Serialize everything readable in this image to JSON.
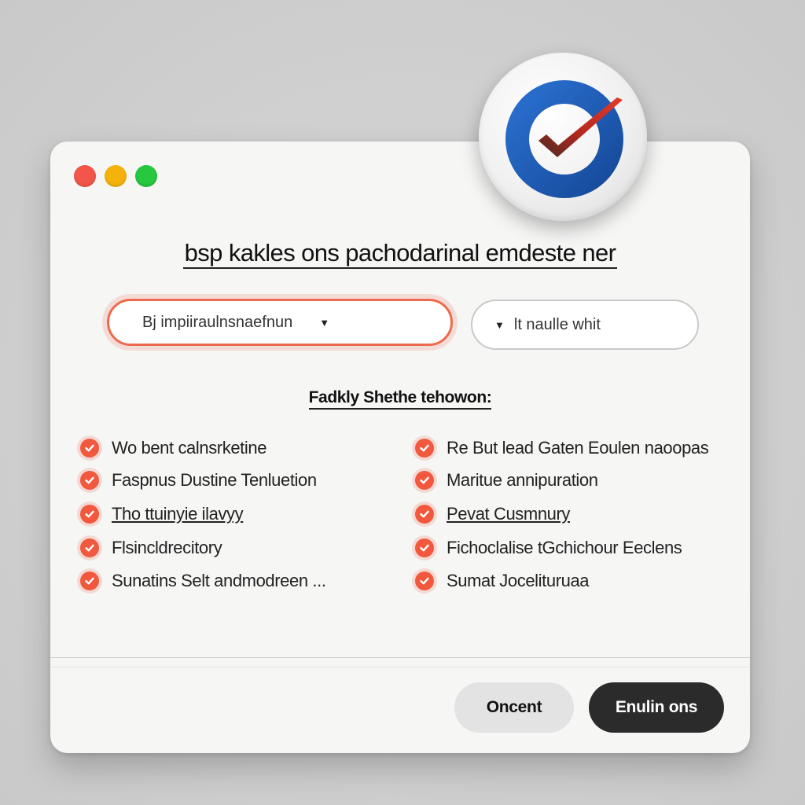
{
  "window": {
    "heading": "bsp kakles ons pachodarinal emdeste ner",
    "subheading": "Fadkly Shethe tehowon:",
    "select_primary": {
      "value": "Bj impiiraulnsnaefnun"
    },
    "select_secondary": {
      "value": "lt naulle whit"
    },
    "features_left": [
      {
        "label": "Wo bent calnsrketine"
      },
      {
        "label": "Faspnus Dustine Tenluetion"
      },
      {
        "label": "Tho ttuinyie ilavyy"
      },
      {
        "label": "Flsincldrecitory"
      },
      {
        "label": "Sunatins Selt andmodreen ..."
      }
    ],
    "features_right": [
      {
        "label": "Re But lead Gaten Eoulen naoopas"
      },
      {
        "label": "Maritue annipuration"
      },
      {
        "label": "Pevat Cusmnury"
      },
      {
        "label": "Fichoclalise tGchichour Eeclens"
      },
      {
        "label": "Sumat Jocelituruaa"
      }
    ],
    "buttons": {
      "cancel_label": "Oncent",
      "primary_label": "Enulin ons"
    }
  },
  "colors": {
    "accent": "#f1583d",
    "primary_button": "#2b2b2b",
    "icon_ring": "#1f5fb8",
    "icon_check": "#d6322a"
  },
  "icons": {
    "app_icon": "blue-ring-checkmark-icon",
    "feature_check": "check-circle-icon",
    "dropdown": "caret-down-icon"
  }
}
